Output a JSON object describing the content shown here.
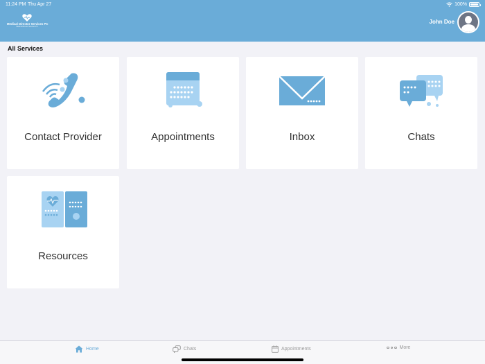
{
  "status_bar": {
    "time": "11:24 PM",
    "date": "Thu Apr 27",
    "battery": "100%"
  },
  "header": {
    "logo_name": "Medical Director Services PC",
    "logo_tagline": "Medical Director Services PC",
    "user_name": "John Doe"
  },
  "section_title": "All Services",
  "tiles": [
    {
      "label": "Contact Provider",
      "icon": "phone-icon"
    },
    {
      "label": "Appointments",
      "icon": "calendar-icon"
    },
    {
      "label": "Inbox",
      "icon": "envelope-icon"
    },
    {
      "label": "Chats",
      "icon": "chat-bubbles-icon"
    },
    {
      "label": "Resources",
      "icon": "resources-icon"
    }
  ],
  "tab_bar": [
    {
      "label": "Home",
      "icon": "home-icon",
      "active": true
    },
    {
      "label": "Chats",
      "icon": "chat-icon",
      "active": false
    },
    {
      "label": "Appointments",
      "icon": "calendar-icon",
      "active": false
    },
    {
      "label": "More",
      "icon": "more-icon",
      "active": false
    }
  ],
  "colors": {
    "brand": "#6aacd8",
    "brand_light": "#a8d3f2",
    "background": "#f2f2f7"
  }
}
